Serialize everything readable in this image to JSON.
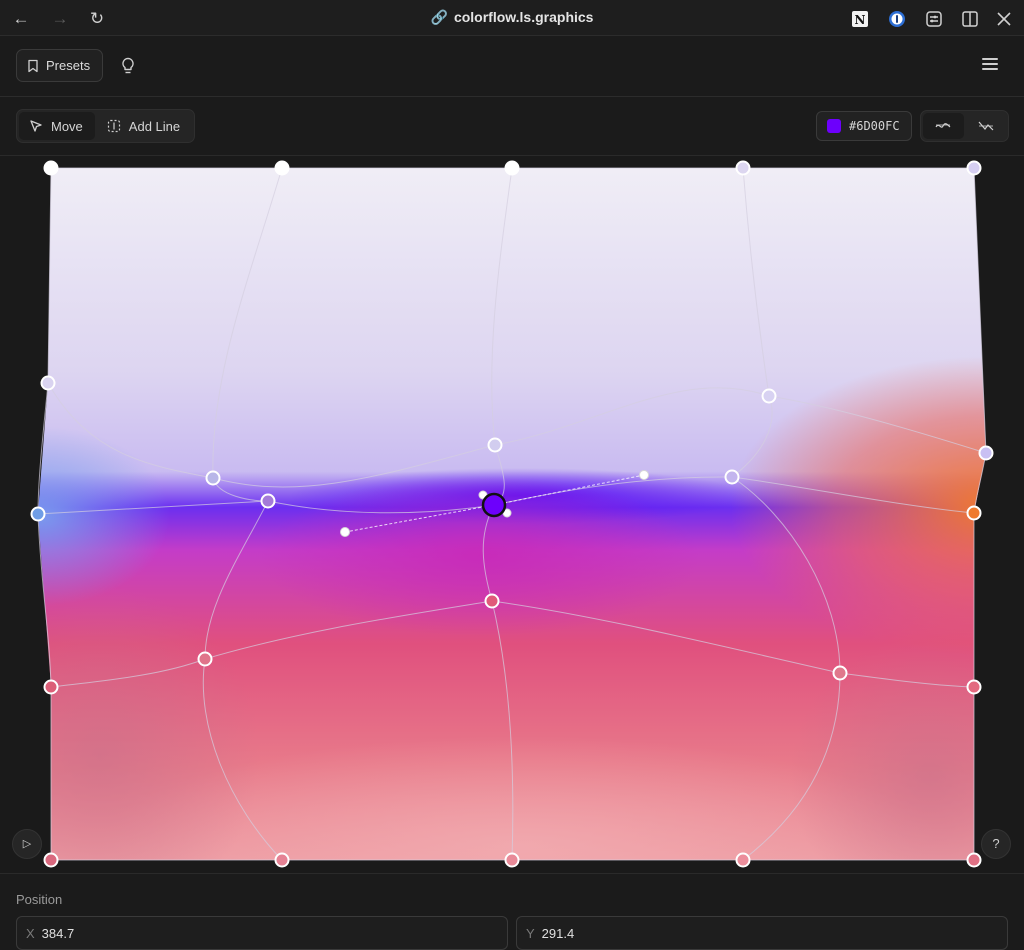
{
  "browser": {
    "url": "colorflow.ls.graphics",
    "extensions": [
      "notion-icon",
      "onepassword-icon",
      "sliders-icon",
      "split-view-icon",
      "close-icon"
    ]
  },
  "toolbar": {
    "presets_label": "Presets"
  },
  "tools": {
    "move_label": "Move",
    "add_line_label": "Add Line"
  },
  "color": {
    "hex": "#6D00FC",
    "swatch": "#6D00FC"
  },
  "position": {
    "label": "Position",
    "x_axis": "X",
    "x_value": "384.7",
    "y_axis": "Y",
    "y_value": "291.4"
  },
  "help_label": "?"
}
